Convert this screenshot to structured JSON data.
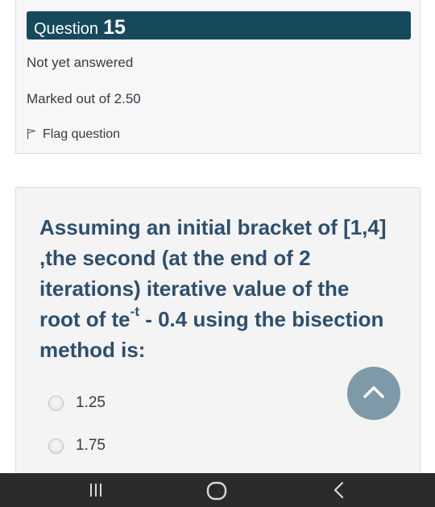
{
  "question": {
    "label": "Question",
    "number": "15",
    "status": "Not yet answered",
    "marks": "Marked out of 2.50",
    "flag_label": "Flag question",
    "text_before_sup": "Assuming an initial bracket of [1,4] ,the second (at the end of 2 iterations) iterative value of the root of te",
    "text_sup": "-t",
    "text_after_sup": " - 0.4 using the bisection method is:"
  },
  "options": [
    {
      "label": "1.25",
      "selected": false
    },
    {
      "label": "1.75",
      "selected": false
    }
  ],
  "icons": {
    "flag": "flag-icon",
    "scroll_top": "chevron-up-icon",
    "nav_recents": "recents-icon",
    "nav_home": "home-icon",
    "nav_back": "back-icon"
  },
  "colors": {
    "header_bg": "#16495c",
    "question_text": "#2e4f6e",
    "scroll_button": "#7e9aa8",
    "nav_bar": "#2b2b2b"
  }
}
